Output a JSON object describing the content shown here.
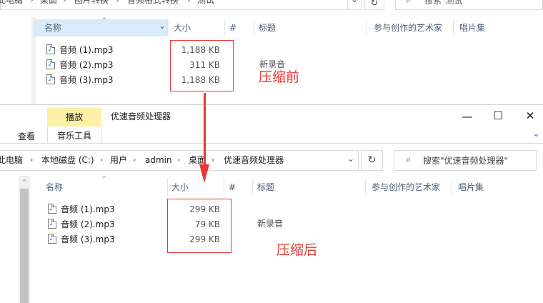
{
  "window_top": {
    "breadcrumb": [
      "此电脑",
      "桌面",
      "图片转换",
      "音频格式转换",
      "测试"
    ],
    "search_placeholder": "搜索\"测试\"",
    "columns": {
      "name": "名称",
      "size": "大小",
      "track": "#",
      "title": "标题",
      "artists": "参与创作的艺术家",
      "album": "唱片集"
    },
    "files": [
      {
        "name": "音频 (1).mp3",
        "size": "1,188 KB",
        "title": ""
      },
      {
        "name": "音频 (2).mp3",
        "size": "311 KB",
        "title": "新录音"
      },
      {
        "name": "音频 (3).mp3",
        "size": "1,188 KB",
        "title": ""
      }
    ],
    "annotation": "压缩前"
  },
  "window_bottom": {
    "ribbon": {
      "context_tab": "播放",
      "tab_view": "查看",
      "tab_music_tools": "音乐工具"
    },
    "title": "优速音频处理器",
    "window_controls": {
      "minimize": "—",
      "maximize": "☐",
      "close": "✕"
    },
    "breadcrumb": [
      "此电脑",
      "本地磁盘 (C:)",
      "用户",
      "admin",
      "桌面",
      "优速音频处理器"
    ],
    "search_placeholder": "搜索\"优速音频处理器\"",
    "columns": {
      "name": "名称",
      "size": "大小",
      "track": "#",
      "title": "标题",
      "artists": "参与创作的艺术家",
      "album": "唱片集"
    },
    "files": [
      {
        "name": "音频 (1).mp3",
        "size": "299 KB",
        "title": ""
      },
      {
        "name": "音频 (2).mp3",
        "size": "79 KB",
        "title": "新录音"
      },
      {
        "name": "音频 (3).mp3",
        "size": "299 KB",
        "title": ""
      }
    ],
    "annotation": "压缩后"
  },
  "icons": {
    "refresh": "↻",
    "search": "⌕",
    "chevron_down": "⌄",
    "chevron_right": "›",
    "sort_up": "^",
    "expand": "⌄",
    "music_note": "♪"
  },
  "colors": {
    "annotation_red": "#e53935",
    "header_selected": "#d9ebf9",
    "context_tab": "#fbf0a5",
    "header_text": "#4c607a"
  }
}
